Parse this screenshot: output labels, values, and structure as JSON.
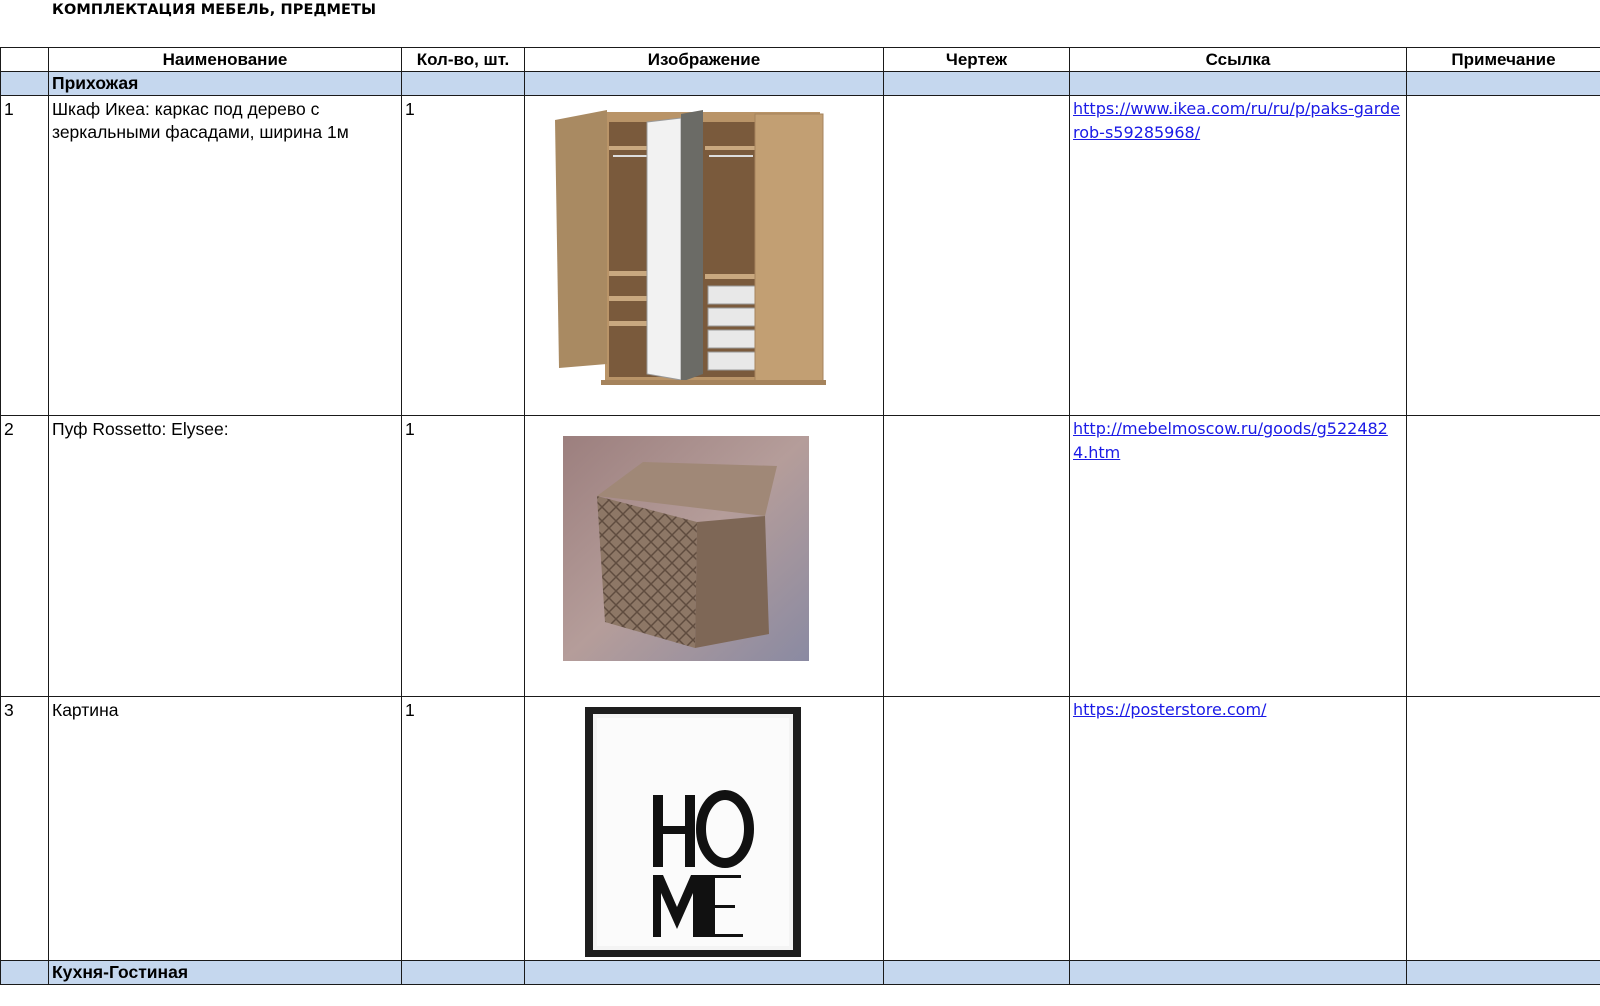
{
  "document": {
    "title": "КОМПЛЕКТАЦИЯ МЕБЕЛЬ, ПРЕДМЕТЫ"
  },
  "table": {
    "headers": {
      "num": "",
      "name": "Наименование",
      "qty": "Кол-во, шт.",
      "image": "Изображение",
      "drawing": "Чертеж",
      "link": "Ссылка",
      "note": "Примечание"
    },
    "section_hallway": "Прихожая",
    "rows": [
      {
        "num": "1",
        "name": "Шкаф Икеа: каркас под дерево с зеркальными фасадами, ширина 1м",
        "qty": "1",
        "image": "wardrobe-image",
        "drawing": "",
        "link": "https://www.ikea.com/ru/ru/p/paks-garderob-s59285968/",
        "note": ""
      },
      {
        "num": "2",
        "name": "Пуф  Rossetto: Elysee:",
        "qty": "1",
        "image": "pouf-image",
        "drawing": "",
        "link": "http://mebelmoscow.ru/goods/g5224824.htm",
        "note": ""
      },
      {
        "num": "3",
        "name": "Картина",
        "qty": "1",
        "image": "poster-image",
        "drawing": "",
        "link": "https://posterstore.com/",
        "note": ""
      }
    ],
    "section_kitchen": "Кухня-Гостиная"
  },
  "colors": {
    "section_fill": "#c5d7ee",
    "link": "#1a1ae6",
    "grid": "#1a1a1a"
  }
}
